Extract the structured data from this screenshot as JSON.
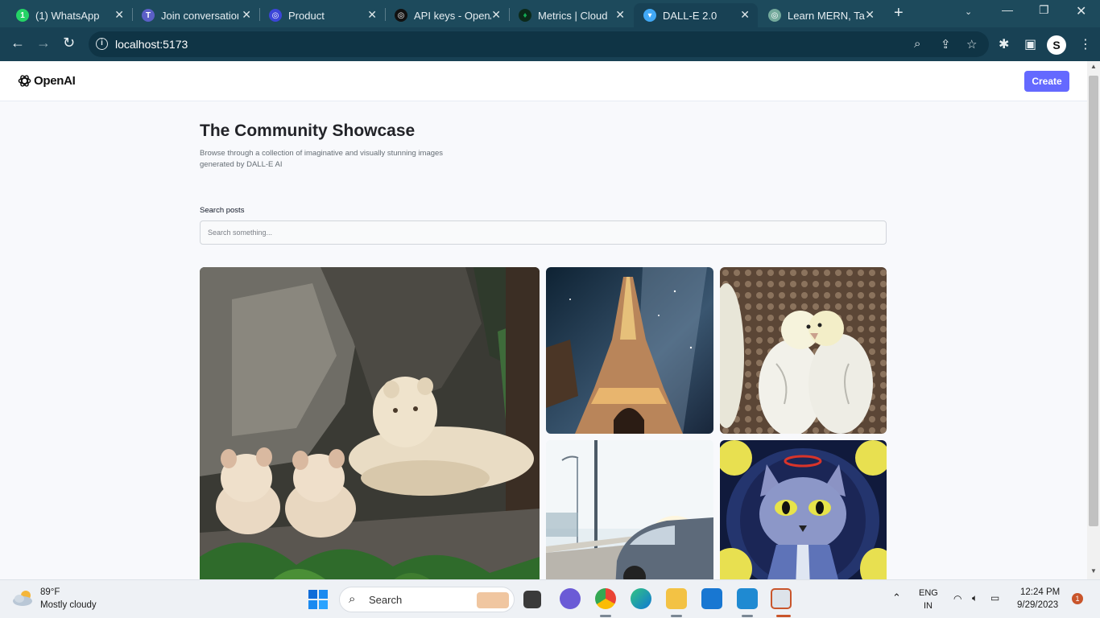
{
  "browser": {
    "tabs": [
      {
        "title": "(1) WhatsApp",
        "icon": "whatsapp-icon",
        "color": "#25d366"
      },
      {
        "title": "Join conversation",
        "icon": "teams-icon",
        "color": "#5b5fc7"
      },
      {
        "title": "Product",
        "icon": "openai-icon",
        "color": "#3b45d8"
      },
      {
        "title": "API keys - OpenAI",
        "icon": "openai-icon",
        "color": "#111111"
      },
      {
        "title": "Metrics | Cloud",
        "icon": "mongodb-icon",
        "color": "#13aa52"
      },
      {
        "title": "DALL-E 2.0",
        "icon": "vite-icon",
        "color": "#41a8f5",
        "active": true
      },
      {
        "title": "Learn MERN, Tai",
        "icon": "chatgpt-icon",
        "color": "#74aa9c"
      }
    ],
    "url": "localhost:5173",
    "profile_initial": "S"
  },
  "site": {
    "brand": "OpenAI",
    "create_label": "Create",
    "title": "The Community Showcase",
    "subtitle": "Browse through a collection of imaginative and visually stunning images generated by DALL-E AI",
    "search_label": "Search posts",
    "search_placeholder": "Search something...",
    "accent": "#6469ff",
    "images": [
      {
        "name": "white-lions-image",
        "subject": "white lioness with two cubs on rocks"
      },
      {
        "name": "eiffel-tower-image",
        "subject": "eiffel tower under milky way night sky"
      },
      {
        "name": "budgies-image",
        "subject": "two white budgies cuddling"
      },
      {
        "name": "highway-car-image",
        "subject": "car on sunny highway"
      },
      {
        "name": "cat-painting-image",
        "subject": "crayon painting of a blue cat with halo"
      }
    ]
  },
  "taskbar": {
    "weather_temp": "89°F",
    "weather_desc": "Mostly cloudy",
    "search_label": "Search",
    "lang_top": "ENG",
    "lang_bottom": "IN",
    "time": "12:24 PM",
    "date": "9/29/2023",
    "notification_count": "1"
  }
}
